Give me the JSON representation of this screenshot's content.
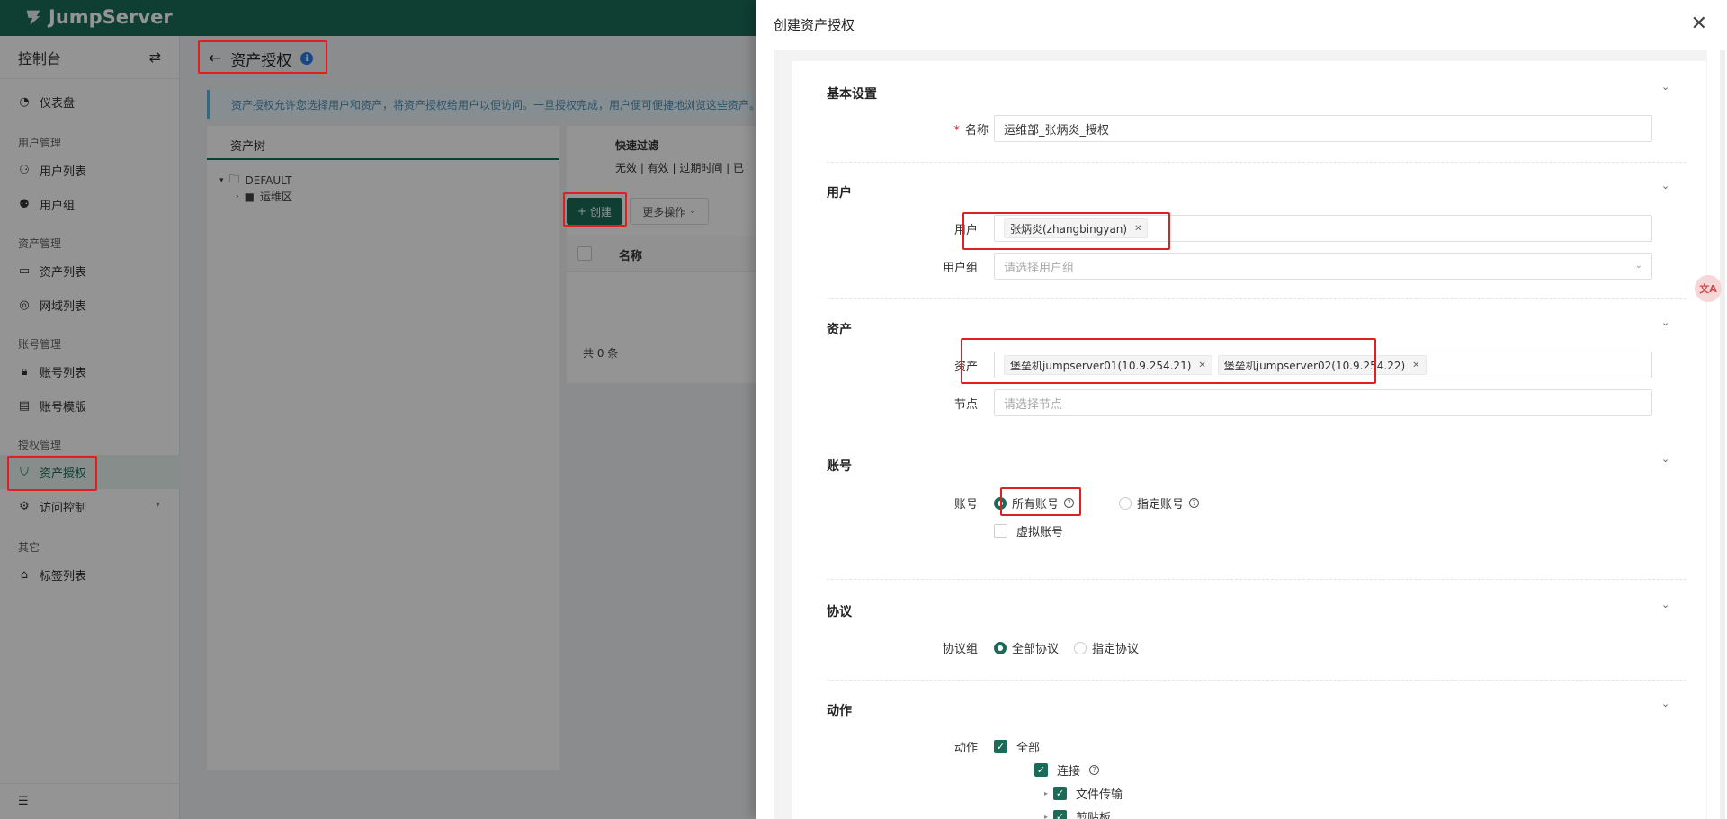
{
  "app": {
    "brand": "JumpServer"
  },
  "sidebar": {
    "title": "控制台",
    "items": [
      {
        "label": "仪表盘",
        "icon": "dashboard-icon"
      },
      {
        "label": "用户列表",
        "icon": "user-icon"
      },
      {
        "label": "用户组",
        "icon": "user-group-icon"
      },
      {
        "label": "资产列表",
        "icon": "monitor-icon"
      },
      {
        "label": "网域列表",
        "icon": "location-icon"
      },
      {
        "label": "账号列表",
        "icon": "lock-icon"
      },
      {
        "label": "账号模版",
        "icon": "template-icon"
      },
      {
        "label": "资产授权",
        "icon": "shield-icon"
      },
      {
        "label": "访问控制",
        "icon": "gear-icon"
      },
      {
        "label": "标签列表",
        "icon": "tag-icon"
      }
    ],
    "groups": [
      "用户管理",
      "资产管理",
      "账号管理",
      "授权管理",
      "其它"
    ]
  },
  "page": {
    "title": "资产授权",
    "notice": "资产授权允许您选择用户和资产，将资产授权给用户以便访问。一旦授权完成，用户便可便捷地浏览这些资产。",
    "tree_title": "资产树",
    "tree_root": "DEFAULT",
    "tree_child": "运维区",
    "quick_filter_title": "快速过滤",
    "quick_filters": "无效 | 有效 | 过期时间 | 已",
    "create_label": "创建",
    "more_label": "更多操作",
    "col_name": "名称",
    "total": "共 0 条"
  },
  "drawer": {
    "title": "创建资产授权",
    "sections": {
      "basic": "基本设置",
      "user": "用户",
      "asset": "资产",
      "account": "账号",
      "protocol": "协议",
      "action": "动作"
    },
    "fields": {
      "name_label": "名称",
      "name_value": "运维部_张炳炎_授权",
      "users_label": "用户",
      "users": [
        "张炳炎(zhangbingyan)"
      ],
      "user_groups_label": "用户组",
      "user_groups_placeholder": "请选择用户组",
      "assets_label": "资产",
      "assets": [
        "堡垒机jumpserver01(10.9.254.21)",
        "堡垒机jumpserver02(10.9.254.22)"
      ],
      "nodes_label": "节点",
      "nodes_placeholder": "请选择节点",
      "accounts_label": "账号",
      "account_all": "所有账号",
      "account_specified": "指定账号",
      "virtual_account": "虚拟账号",
      "protocol_group_label": "协议组",
      "protocol_all": "全部协议",
      "protocol_specified": "指定协议",
      "action_label": "动作",
      "action_all": "全部",
      "action_connect": "连接",
      "action_transfer": "文件传输",
      "action_clipboard": "剪贴板"
    },
    "account_mode": "所有账号",
    "protocol_mode": "全部协议"
  },
  "colors": {
    "brand": "#1b6b58",
    "highlight": "#e02020"
  }
}
